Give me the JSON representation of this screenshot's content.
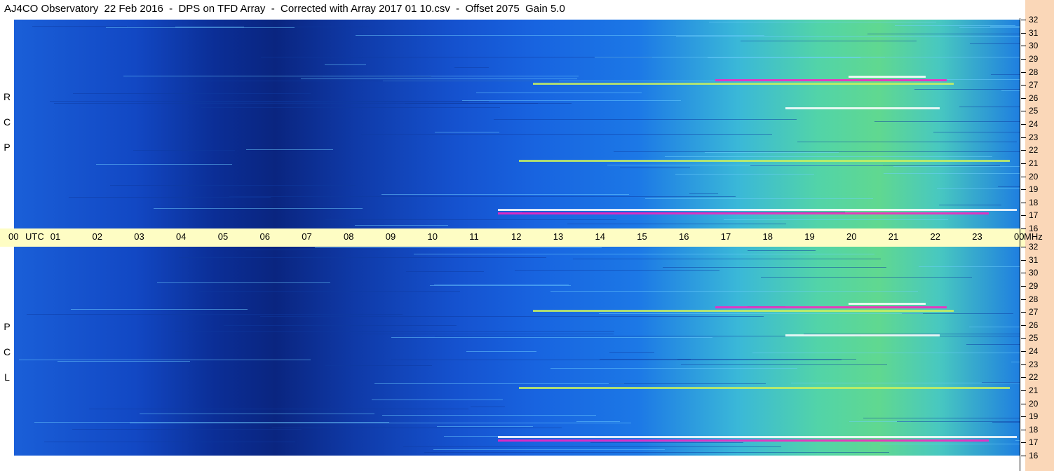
{
  "title": "AJ4CO Observatory  22 Feb 2016  -  DPS on TFD Array  -  Corrected with Array 2017 01 10.csv  -  Offset 2075  Gain 5.0",
  "chart_data": [
    {
      "type": "heatmap",
      "panel": "RCP",
      "ylabel_letters": [
        "R",
        "C",
        "P"
      ],
      "x": [
        "00",
        "01",
        "02",
        "03",
        "04",
        "05",
        "06",
        "07",
        "08",
        "09",
        "10",
        "11",
        "12",
        "13",
        "14",
        "15",
        "16",
        "17",
        "18",
        "19",
        "20",
        "21",
        "22",
        "23",
        "00"
      ],
      "x_unit": "UTC",
      "y": [
        16,
        17,
        18,
        19,
        20,
        21,
        22,
        23,
        24,
        25,
        26,
        27,
        28,
        29,
        30,
        31,
        32
      ],
      "y_unit": "MHz",
      "ylim": [
        16,
        32
      ]
    },
    {
      "type": "heatmap",
      "panel": "LCP",
      "ylabel_letters": [
        "L",
        "C",
        "P"
      ],
      "x": [
        "00",
        "01",
        "02",
        "03",
        "04",
        "05",
        "06",
        "07",
        "08",
        "09",
        "10",
        "11",
        "12",
        "13",
        "14",
        "15",
        "16",
        "17",
        "18",
        "19",
        "20",
        "21",
        "22",
        "23",
        "00"
      ],
      "x_unit": "UTC",
      "y": [
        16,
        17,
        18,
        19,
        20,
        21,
        22,
        23,
        24,
        25,
        26,
        27,
        28,
        29,
        30,
        31,
        32
      ],
      "y_unit": "MHz",
      "ylim": [
        16,
        32
      ]
    }
  ],
  "colors": {
    "axis_bg": "#fefdc4",
    "mhz_bg": "#fad7b8",
    "low": "#0a2580",
    "mid": "#1c78e6",
    "high": "#52d4a8",
    "burst": "#ff20c0"
  }
}
